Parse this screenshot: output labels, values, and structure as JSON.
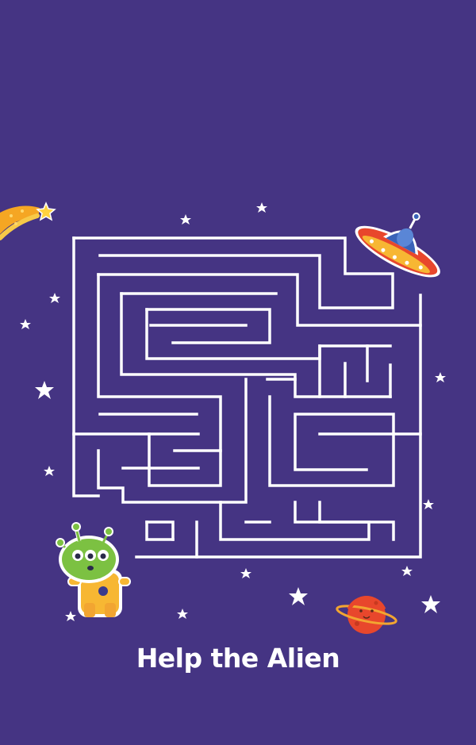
{
  "title": "Help the Alien",
  "colors": {
    "background": "#453483",
    "maze_wall": "#ffffff",
    "alien_skin": "#7cc142",
    "alien_suit": "#f7b733",
    "ufo_body": "#e8472c",
    "ufo_dome": "#3a63b8",
    "planet": "#e8472c",
    "planet_ring": "#f2a531",
    "shooting_star": "#f5b82e"
  },
  "icons": {
    "start": "alien-character-icon",
    "goal": "ufo-spaceship-icon",
    "decor": [
      "planet-icon",
      "shooting-star-icon",
      "star-icon"
    ]
  }
}
